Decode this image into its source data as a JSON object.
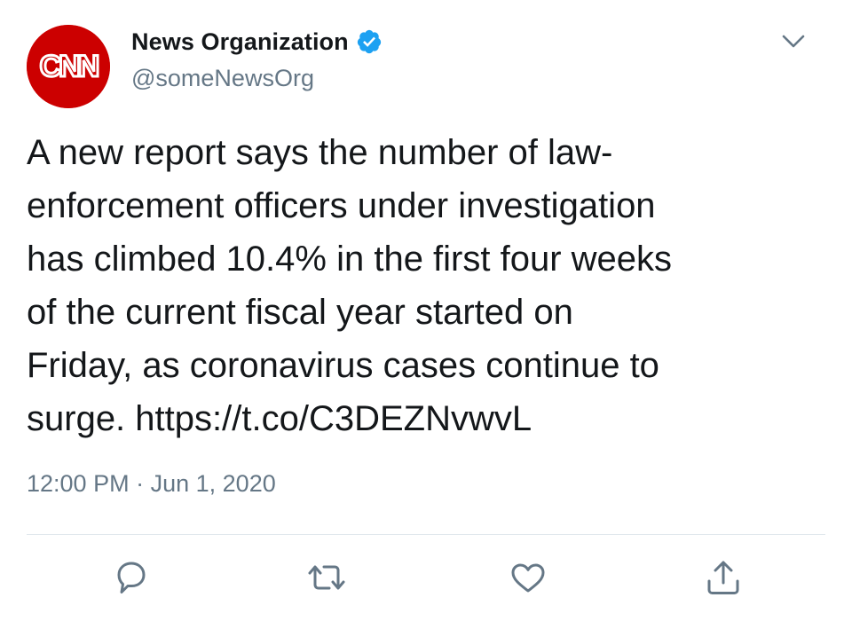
{
  "author": {
    "logo_text": "CNN",
    "display_name": "News Organization",
    "handle": "@someNewsOrg",
    "verified": true,
    "logo_color": "#cc0000",
    "verified_color": "#1da1f2"
  },
  "tweet": {
    "lines": [
      "A new report says the number of law-",
      "enforcement officers under investigation",
      "has climbed 10.4% in the first four weeks",
      "of the current fiscal year started on",
      "Friday, as coronavirus cases continue to",
      "surge."
    ],
    "link": "https://t.co/C3DEZNvwvL",
    "time": "12:00 PM",
    "separator": "·",
    "date": "Jun 1, 2020"
  },
  "icons": {
    "menu": "chevron-down-icon",
    "verified": "verified-badge-icon",
    "reply": "reply-icon",
    "retweet": "retweet-icon",
    "like": "heart-icon",
    "share": "share-icon"
  },
  "colors": {
    "text": "#14171a",
    "secondary": "#657786",
    "divider": "#e1e8ed"
  }
}
